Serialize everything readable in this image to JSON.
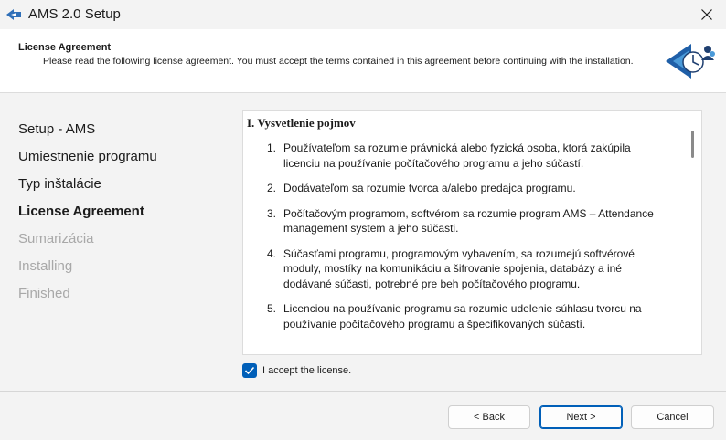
{
  "window": {
    "title": "AMS 2.0 Setup"
  },
  "header": {
    "title": "License Agreement",
    "subtitle": "Please read the following license agreement. You must accept the terms contained in this agreement before continuing with the installation."
  },
  "steps": [
    {
      "label": "Setup - AMS",
      "state": "done"
    },
    {
      "label": "Umiestnenie programu",
      "state": "done"
    },
    {
      "label": "Typ inštalácie",
      "state": "done"
    },
    {
      "label": "License Agreement",
      "state": "active"
    },
    {
      "label": "Sumarizácia",
      "state": "pending"
    },
    {
      "label": "Installing",
      "state": "pending"
    },
    {
      "label": "Finished",
      "state": "pending"
    }
  ],
  "license": {
    "heading": "I. Vysvetlenie pojmov",
    "items": [
      {
        "num": "1.",
        "text": "Používateľom sa rozumie právnická alebo fyzická osoba, ktorá zakúpila licenciu na používanie počítačového programu a jeho súčastí."
      },
      {
        "num": "2.",
        "text": "Dodávateľom sa rozumie tvorca a/alebo predajca programu."
      },
      {
        "num": "3.",
        "text": "Počítačovým programom, softvérom sa rozumie program AMS – Attendance management system a jeho súčasti."
      },
      {
        "num": "4.",
        "text": "Súčasťami programu, programovým vybavením, sa rozumejú softvérové moduly, mostíky na komunikáciu a šifrovanie spojenia, databázy a iné dodávané súčasti, potrebné pre beh počítačového programu."
      },
      {
        "num": "5.",
        "text": "Licenciou na používanie programu sa rozumie udelenie súhlasu tvorcu na používanie počítačového programu a špecifikovaných súčastí."
      }
    ]
  },
  "accept": {
    "label": "I accept the license.",
    "checked": true
  },
  "buttons": {
    "back": "< Back",
    "next": "Next >",
    "cancel": "Cancel"
  },
  "colors": {
    "accent": "#005fb8",
    "disabled_text": "#a8a8a8"
  }
}
